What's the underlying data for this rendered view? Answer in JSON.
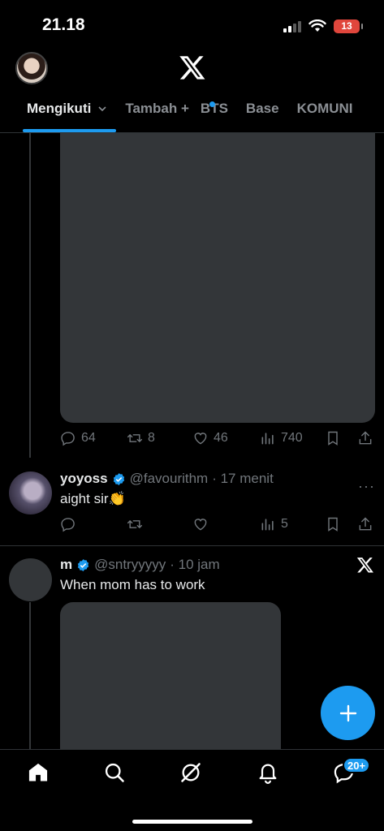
{
  "status_bar": {
    "time": "21.18",
    "battery": "13"
  },
  "header": {
    "tabs": [
      {
        "label": "Mengikuti"
      },
      {
        "label": "Tambah +"
      },
      {
        "label": "BTS"
      },
      {
        "label": "Base"
      },
      {
        "label": "KOMUNI"
      }
    ]
  },
  "tweets": [
    {
      "stats": {
        "replies": "64",
        "reposts": "8",
        "likes": "46",
        "views": "740"
      }
    },
    {
      "name": "yoyoss",
      "handle": "@favourithm",
      "time": "· 17 menit",
      "text": "aight sir👏",
      "stats": {
        "views": "5"
      }
    },
    {
      "name": "m",
      "handle": "@sntryyyyy",
      "time": "· 10 jam",
      "text": "When mom has to work"
    }
  ],
  "bottom_nav": {
    "messages_badge": "20+"
  },
  "icons": [
    "x-logo-icon",
    "chevron-down-icon",
    "verified-icon",
    "reply-icon",
    "repost-icon",
    "like-icon",
    "views-icon",
    "bookmark-icon",
    "share-icon",
    "more-icon",
    "compose-plus-icon",
    "home-icon",
    "search-icon",
    "grok-icon",
    "notifications-icon",
    "messages-icon"
  ],
  "colors": {
    "accent": "#1d9bf0",
    "background": "#000000",
    "muted": "#71767b"
  }
}
